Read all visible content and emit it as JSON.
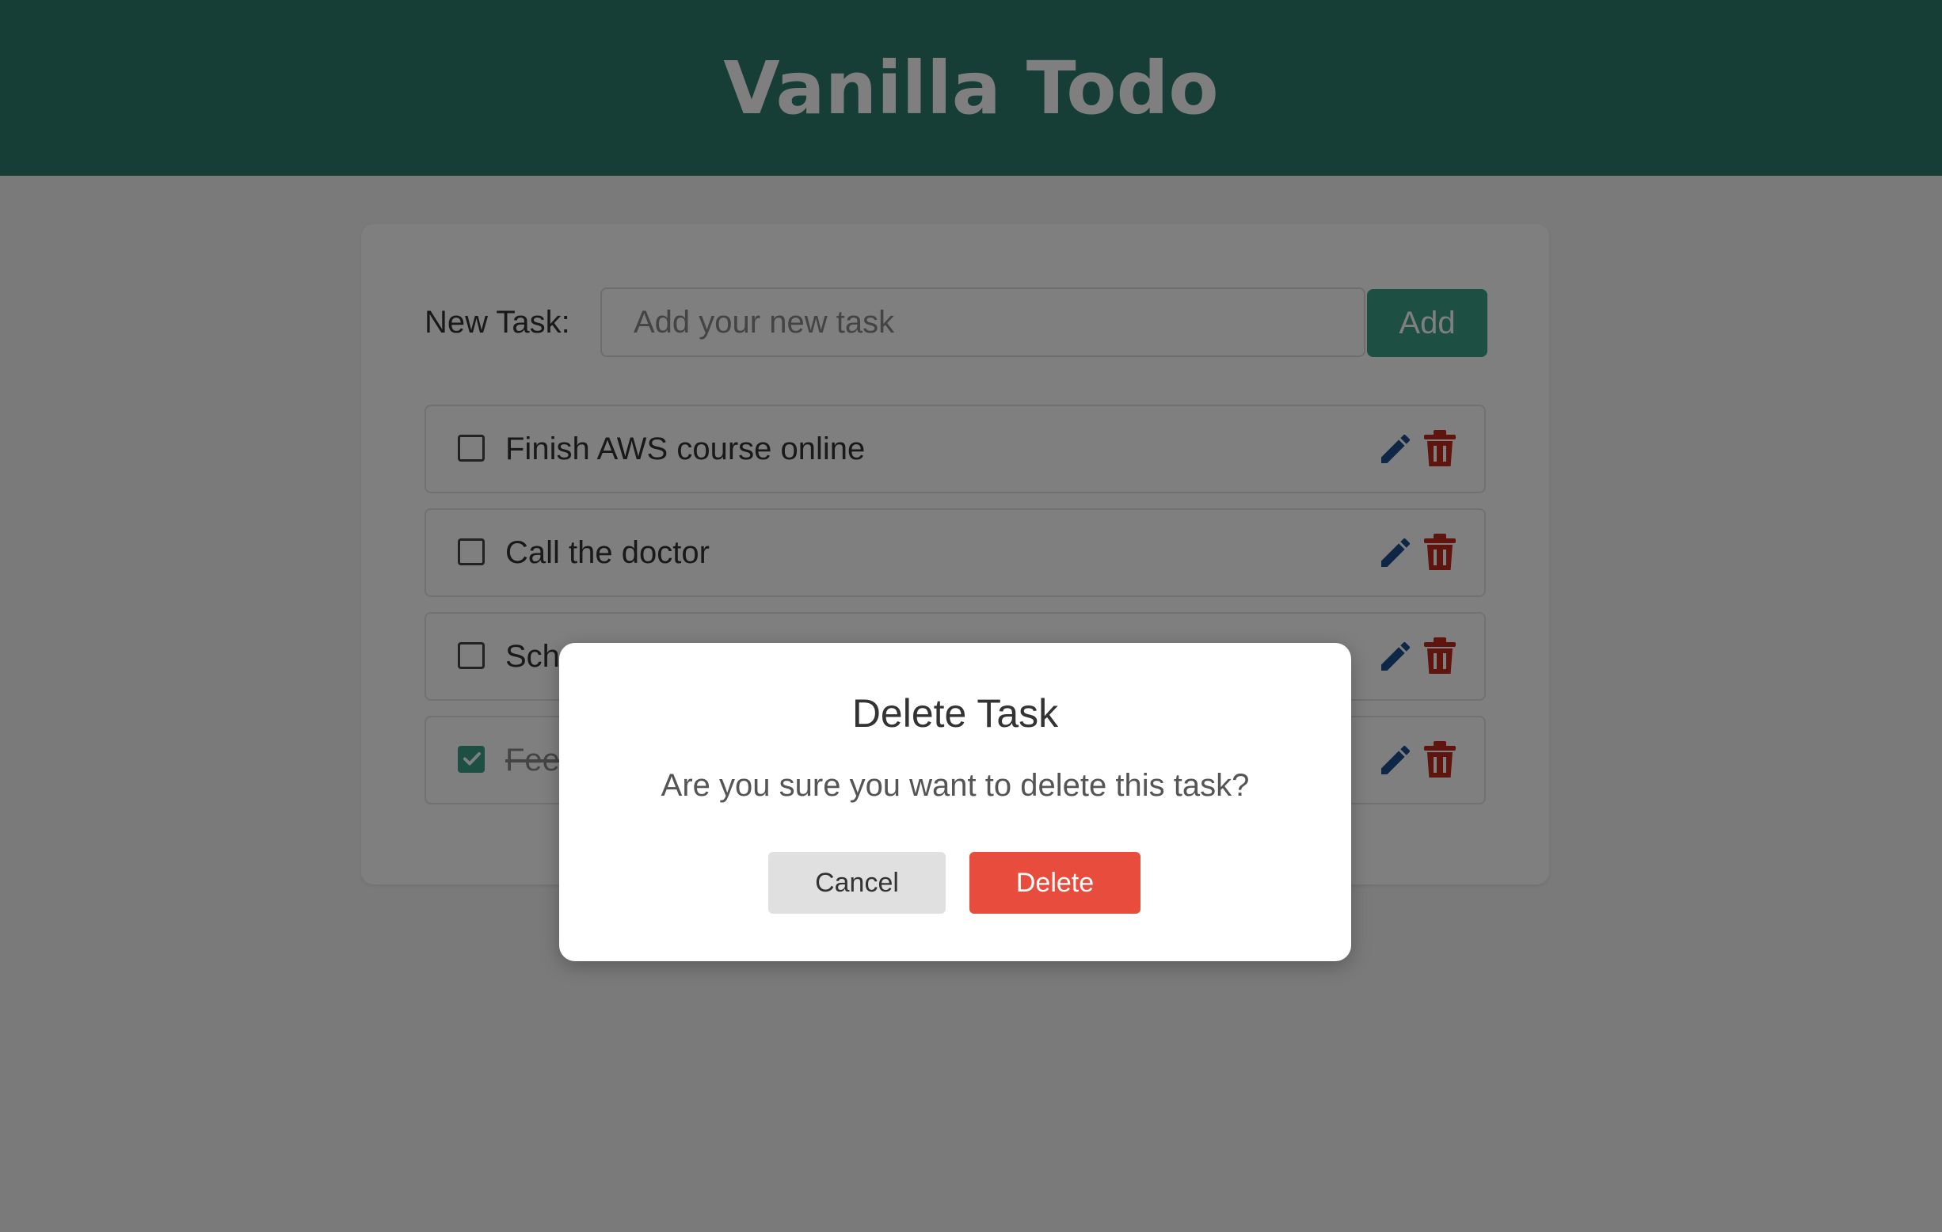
{
  "header": {
    "title": "Vanilla Todo"
  },
  "new_task": {
    "label": "New Task:",
    "input_value": "",
    "placeholder": "Add your new task",
    "add_label": "Add"
  },
  "tasks": [
    {
      "text": "Finish AWS course online",
      "completed": false
    },
    {
      "text": "Call the doctor",
      "completed": false
    },
    {
      "text": "Sch",
      "completed": false
    },
    {
      "text": "Feed",
      "completed": true
    }
  ],
  "modal": {
    "title": "Delete Task",
    "message": "Are you sure you want to delete this task?",
    "cancel_label": "Cancel",
    "delete_label": "Delete"
  },
  "colors": {
    "header_bg": "#2f7d6d",
    "accent": "#3a9e86",
    "edit_icon": "#1f4e8c",
    "delete_icon": "#c0281d",
    "delete_button": "#e74c3c",
    "cancel_button": "#e0e0e0"
  },
  "icons": {
    "edit": "pencil-icon",
    "delete": "trash-icon",
    "check": "check-icon"
  }
}
